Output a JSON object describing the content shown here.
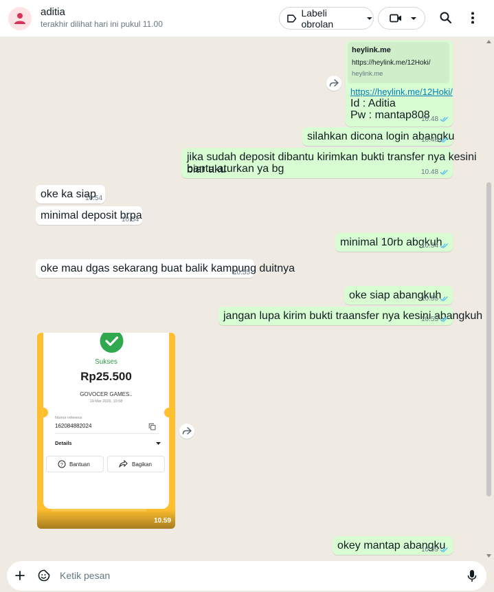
{
  "header": {
    "name": "aditia",
    "status": "terakhir dilihat hari ini pukul 11.00",
    "label_button": "Labeli obrolan"
  },
  "messages": [
    {
      "link_preview": {
        "title": "heylink.me",
        "url": "https://heylink.me/12Hoki/",
        "domain": "heylink.me"
      },
      "link": "https://heylink.me/12Hoki/",
      "line2": "Id : Aditia",
      "line3": "Pw : mantap808",
      "time": "10.48"
    },
    {
      "text": "silahkan dicona login abangku",
      "time": "10.48"
    },
    {
      "text_line1": "jika sudah deposit dibantu kirimkan bukti transfer nya kesini biar aku",
      "text_line2": "bantu aturkan ya bg",
      "time": "10.48"
    },
    {
      "text": "oke ka siap",
      "time": "10.54"
    },
    {
      "text": "minimal deposit brpa",
      "time": "10.54"
    },
    {
      "text": "minimal 10rb abgkuh",
      "time": "10.54"
    },
    {
      "text": "oke mau dgas sekarang buat balik kampung duitnya",
      "time": "10.55"
    },
    {
      "text": "oke siap abangkuh",
      "time": "10.55"
    },
    {
      "text": "jangan lupa kirim bukti traansfer nya kesini abangkuh",
      "time": "10.55"
    },
    {
      "text": "okey mantap abangku",
      "time": "10.59"
    }
  ],
  "image_message": {
    "status": "Sukses",
    "amount": "Rp25.500",
    "merchant": "GOVOCER GAMES..",
    "date": "19 Mar 2026, 10:58",
    "ref_label": "Nomor referensi",
    "ref_value": "162084882024",
    "details": "Details",
    "btn_help": "Bantuan",
    "btn_share": "Bagikan",
    "time": "10.59"
  },
  "composer": {
    "placeholder": "Ketik pesan"
  },
  "colors": {
    "outgoing": "#d9fdd3",
    "incoming": "#ffffff",
    "read_tick": "#53bdeb",
    "background": "#efeae2"
  }
}
